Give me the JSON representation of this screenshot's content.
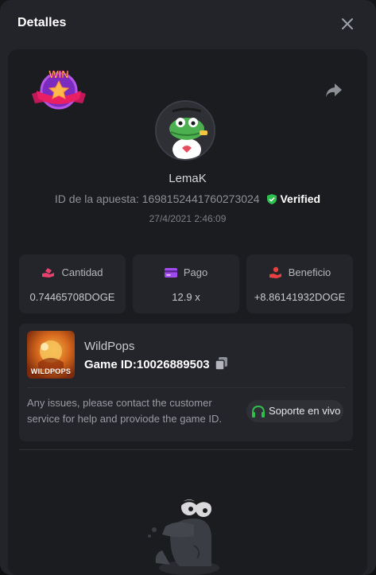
{
  "modal": {
    "title": "Detalles"
  },
  "bet": {
    "win_badge": "WIN",
    "username": "LemaK",
    "bet_id_label": "ID de la apuesta:",
    "bet_id": "1698152441760273024",
    "verified": "Verified",
    "date": "27/4/2021 2:46:09"
  },
  "stats": [
    {
      "label": "Cantidad",
      "value": "0.74465708DOGE",
      "icon": "hand-coin-icon",
      "color": "#e8416e"
    },
    {
      "label": "Pago",
      "value": "12.9 x",
      "icon": "card-icon",
      "color": "#a14bef"
    },
    {
      "label": "Beneficio",
      "value": "+8.86141932DOGE",
      "icon": "profit-hand-icon",
      "color": "#e8413f"
    }
  ],
  "game": {
    "name": "WildPops",
    "thumb_label": "WILDPOPS",
    "id_label": "Game ID:",
    "id": "10026889503",
    "issue_text": "Any issues, please contact the customer service for help and proviode the game ID.",
    "support_label": "Soporte en vivo"
  },
  "colors": {
    "verified": "#2fbf4f",
    "panel": "#1b1c20",
    "card": "#24252b",
    "support_icon": "#2fbf4f"
  }
}
